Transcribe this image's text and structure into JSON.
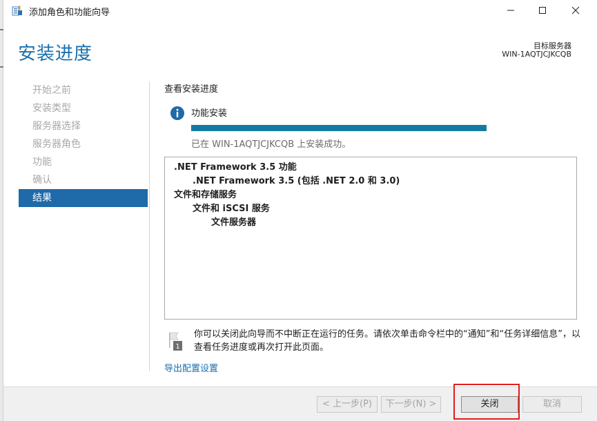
{
  "window": {
    "title": "添加角色和功能向导",
    "controls": [
      "minimize-icon",
      "maximize-icon",
      "close-icon"
    ]
  },
  "header": {
    "page_title": "安装进度",
    "target_label": "目标服务器",
    "target_name": "WIN-1AQTJCJKCQB"
  },
  "nav": {
    "items": [
      {
        "label": "开始之前",
        "active": false
      },
      {
        "label": "安装类型",
        "active": false
      },
      {
        "label": "服务器选择",
        "active": false
      },
      {
        "label": "服务器角色",
        "active": false
      },
      {
        "label": "功能",
        "active": false
      },
      {
        "label": "确认",
        "active": false
      },
      {
        "label": "结果",
        "active": true
      }
    ]
  },
  "content": {
    "section_title": "查看安装进度",
    "feature_install_label": "功能安装",
    "progress_fraction": 1.0,
    "progress_status": "已在 WIN-1AQTJCJKCQB 上安装成功。",
    "results": [
      {
        "text": ".NET Framework 3.5 功能",
        "level": 0
      },
      {
        "text": ".NET Framework 3.5 (包括 .NET 2.0 和 3.0)",
        "level": 1
      },
      {
        "text": "文件和存储服务",
        "level": 0
      },
      {
        "text": "文件和 iSCSI 服务",
        "level": 1
      },
      {
        "text": "文件服务器",
        "level": 2
      }
    ],
    "note": "你可以关闭此向导而不中断正在运行的任务。请依次单击命令栏中的“通知”和“任务详细信息”，以查看任务进度或再次打开此页面。",
    "note_icon_badge": "1",
    "export_link": "导出配置设置"
  },
  "footer": {
    "prev_label": "< 上一步(P)",
    "next_label": "下一步(N) >",
    "close_label": "关闭",
    "cancel_label": "取消"
  },
  "colors": {
    "accent": "#1a6fae",
    "nav_active": "#1f6aa8",
    "progress": "#137ba1",
    "highlight": "#e11d1d"
  }
}
